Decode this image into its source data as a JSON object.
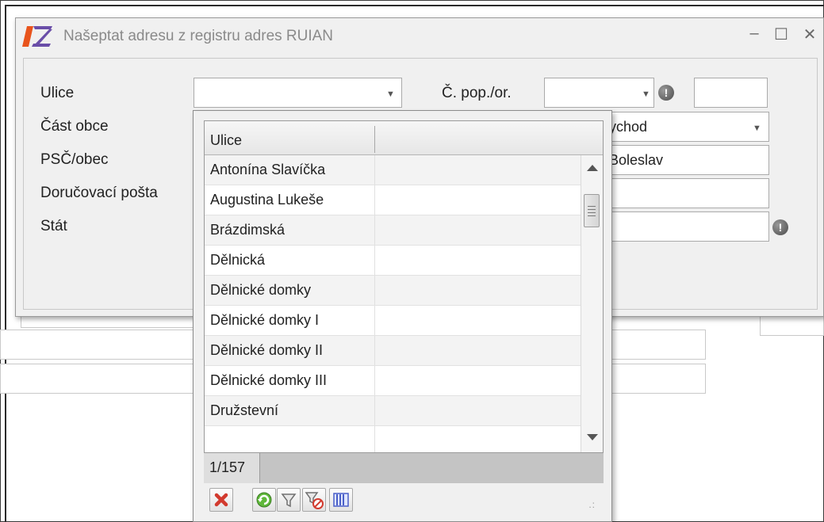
{
  "window": {
    "title": "Našeptat adresu z registru adres RUIAN",
    "controls": {
      "minimize": "–",
      "maximize": "☐",
      "close": "✕"
    }
  },
  "form": {
    "labels": {
      "street": "Ulice",
      "district": "Část obce",
      "zip_city": "PSČ/obec",
      "post_office": "Doručovací pošta",
      "country": "Stát",
      "house_number": "Č. pop./or."
    },
    "values": {
      "street": "",
      "house_number": "",
      "orientation_number": "",
      "district_partial": "ychod",
      "city_partial": "Boleslav"
    }
  },
  "dropdown": {
    "column_header": "Ulice",
    "rows": [
      "Antonína Slavíčka",
      "Augustina Lukeše",
      "Brázdimská",
      "Dělnická",
      "Dělnické domky",
      "Dělnické domky I",
      "Dělnické domky II",
      "Dělnické domky III",
      "Družstevní"
    ],
    "counter": "1/157",
    "toolbar": {
      "cancel_icon": "delete-x-icon",
      "refresh_icon": "refresh-icon",
      "filter_icon": "filter-icon",
      "clear_filter_icon": "clear-filter-icon",
      "columns_icon": "columns-icon"
    }
  },
  "colors": {
    "logo_orange": "#e8541c",
    "logo_purple": "#6a4ea8",
    "dialog_bg": "#f0f0f0"
  }
}
